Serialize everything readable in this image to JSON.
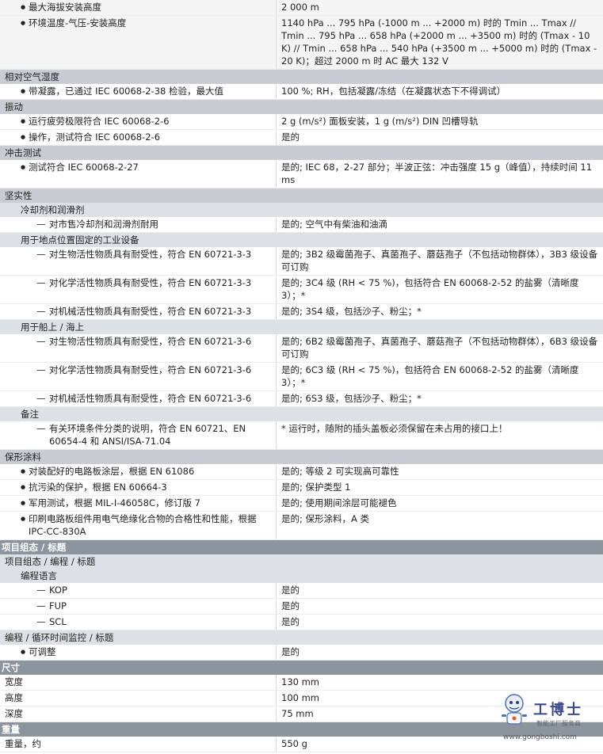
{
  "rows": [
    {
      "kind": "data",
      "shade": true,
      "indent": 1,
      "mark": "bullet",
      "label": "最大海拔安装高度",
      "value": "2 000 m"
    },
    {
      "kind": "data",
      "shade": true,
      "indent": 1,
      "mark": "bullet",
      "label": "环境温度-气压-安装高度",
      "value": "1140 hPa ... 795 hPa (-1000 m ... +2000 m) 时的 Tmin ... Tmax // Tmin ... 795 hPa ... 658 hPa (+2000 m ... +3500 m) 时的 (Tmax - 10 K) // Tmin ... 658 hPa ... 540 hPa (+3500 m ... +5000 m) 时的 (Tmax - 20 K)；超过 2000 m 时 AC 最大 132 V"
    },
    {
      "kind": "sec",
      "label": "相对空气湿度"
    },
    {
      "kind": "data",
      "shade": false,
      "indent": 1,
      "mark": "bullet",
      "label": "带凝露，已通过 IEC 60068-2-38 检验，最大值",
      "value": "100 %; RH，包括凝露/冻结（在凝露状态下不得调试）"
    },
    {
      "kind": "sec",
      "label": "振动"
    },
    {
      "kind": "data",
      "shade": false,
      "indent": 1,
      "mark": "bullet",
      "label": "运行疲劳极限符合 IEC 60068-2-6",
      "value": "2 g (m/s²) 面板安装，1 g (m/s²) DIN 凹槽导轨"
    },
    {
      "kind": "data",
      "shade": false,
      "indent": 1,
      "mark": "bullet",
      "label": "操作，测试符合 IEC 60068-2-6",
      "value": "是的"
    },
    {
      "kind": "sec",
      "label": "冲击测试"
    },
    {
      "kind": "data",
      "shade": false,
      "indent": 1,
      "mark": "bullet",
      "label": "测试符合 IEC 60068-2-27",
      "value": "是的; IEC 68，2-27 部分；半波正弦：冲击强度 15 g（峰值），持续时间 11 ms"
    },
    {
      "kind": "sec",
      "label": "坚实性"
    },
    {
      "kind": "sub",
      "indent": 1,
      "label": "冷却剂和润滑剂"
    },
    {
      "kind": "data",
      "shade": false,
      "indent": 2,
      "mark": "dash",
      "label": "对市售冷却剂和润滑剂耐用",
      "value": "是的; 空气中有柴油和油滴"
    },
    {
      "kind": "sub",
      "indent": 1,
      "label": "用于地点位置固定的工业设备"
    },
    {
      "kind": "data",
      "shade": false,
      "indent": 2,
      "mark": "dash",
      "label": "对生物活性物质具有耐受性，符合 EN 60721-3-3",
      "value": "是的; 3B2 级霉菌孢子、真菌孢子、蘑菇孢子（不包括动物群体），3B3 级设备可订购"
    },
    {
      "kind": "data",
      "shade": false,
      "indent": 2,
      "mark": "dash",
      "label": "对化学活性物质具有耐受性，符合 EN 60721-3-3",
      "value": "是的; 3C4 级 (RH < 75 %)，包括符合 EN 60068-2-52 的盐雾（清晰度 3）；*"
    },
    {
      "kind": "data",
      "shade": false,
      "indent": 2,
      "mark": "dash",
      "label": "对机械活性物质具有耐受性，符合 EN 60721-3-3",
      "value": "是的; 3S4 级，包括沙子、粉尘；*"
    },
    {
      "kind": "sub",
      "indent": 1,
      "label": "用于船上 / 海上"
    },
    {
      "kind": "data",
      "shade": false,
      "indent": 2,
      "mark": "dash",
      "label": "对生物活性物质具有耐受性，符合 EN 60721-3-6",
      "value": "是的; 6B2 级霉菌孢子、真菌孢子、蘑菇孢子（不包括动物群体），6B3 级设备可订购"
    },
    {
      "kind": "data",
      "shade": false,
      "indent": 2,
      "mark": "dash",
      "label": "对化学活性物质具有耐受性，符合 EN 60721-3-6",
      "value": "是的; 6C3 级 (RH < 75 %)，包括符合 EN 60068-2-52 的盐雾（清晰度 3）；*"
    },
    {
      "kind": "data",
      "shade": false,
      "indent": 2,
      "mark": "dash",
      "label": "对机械活性物质具有耐受性，符合 EN 60721-3-6",
      "value": "是的; 6S3 级，包括沙子、粉尘；*"
    },
    {
      "kind": "sub",
      "indent": 1,
      "label": "备注"
    },
    {
      "kind": "data",
      "shade": false,
      "indent": 2,
      "mark": "dash",
      "label": "有关环境条件分类的说明，符合 EN 60721、EN 60654-4 和 ANSI/ISA-71.04",
      "value": "* 运行时，随附的插头盖板必须保留在未占用的接口上！"
    },
    {
      "kind": "sec",
      "label": "保形涂料"
    },
    {
      "kind": "data",
      "shade": false,
      "indent": 1,
      "mark": "bullet",
      "label": "对装配好的电路板涂层，根据 EN 61086",
      "value": "是的; 等级 2 可实现高可靠性"
    },
    {
      "kind": "data",
      "shade": false,
      "indent": 1,
      "mark": "bullet",
      "label": "抗污染的保护，根据 EN 60664-3",
      "value": "是的; 保护类型 1"
    },
    {
      "kind": "data",
      "shade": false,
      "indent": 1,
      "mark": "bullet",
      "label": "军用测试，根据 MIL-I-46058C，修订版 7",
      "value": "是的; 使用期间涂层可能褪色"
    },
    {
      "kind": "data",
      "shade": false,
      "indent": 1,
      "mark": "bullet",
      "label": "印刷电路板组件用电气绝缘化合物的合格性和性能，根据 IPC-CC-830A",
      "value": "是的; 保形涂料，A 类"
    },
    {
      "kind": "major",
      "label": "项目组态 / 标题"
    },
    {
      "kind": "sub",
      "indent": 0,
      "label": "项目组态 / 编程 / 标题"
    },
    {
      "kind": "sub",
      "indent": 1,
      "label": "编程语言"
    },
    {
      "kind": "data",
      "shade": false,
      "indent": 2,
      "mark": "dash",
      "label": "KOP",
      "value": "是的"
    },
    {
      "kind": "data",
      "shade": false,
      "indent": 2,
      "mark": "dash",
      "label": "FUP",
      "value": "是的"
    },
    {
      "kind": "data",
      "shade": false,
      "indent": 2,
      "mark": "dash",
      "label": "SCL",
      "value": "是的"
    },
    {
      "kind": "sub",
      "indent": 0,
      "label": "编程 / 循环时间监控 / 标题"
    },
    {
      "kind": "data",
      "shade": false,
      "indent": 1,
      "mark": "bullet",
      "label": "可调整",
      "value": "是的"
    },
    {
      "kind": "major",
      "label": "尺寸"
    },
    {
      "kind": "data",
      "shade": false,
      "indent": 0,
      "mark": "none",
      "label": "宽度",
      "value": "130 mm"
    },
    {
      "kind": "data",
      "shade": false,
      "indent": 0,
      "mark": "none",
      "label": "高度",
      "value": "100 mm"
    },
    {
      "kind": "data",
      "shade": false,
      "indent": 0,
      "mark": "none",
      "label": "深度",
      "value": "75 mm"
    },
    {
      "kind": "major",
      "label": "重量"
    },
    {
      "kind": "data",
      "shade": false,
      "indent": 0,
      "mark": "none",
      "label": "重量，约",
      "value": "550 g"
    }
  ],
  "watermark": {
    "brand": "工博士",
    "tagline": "智能工厂服务商",
    "url": "www.gongboshi.com"
  }
}
